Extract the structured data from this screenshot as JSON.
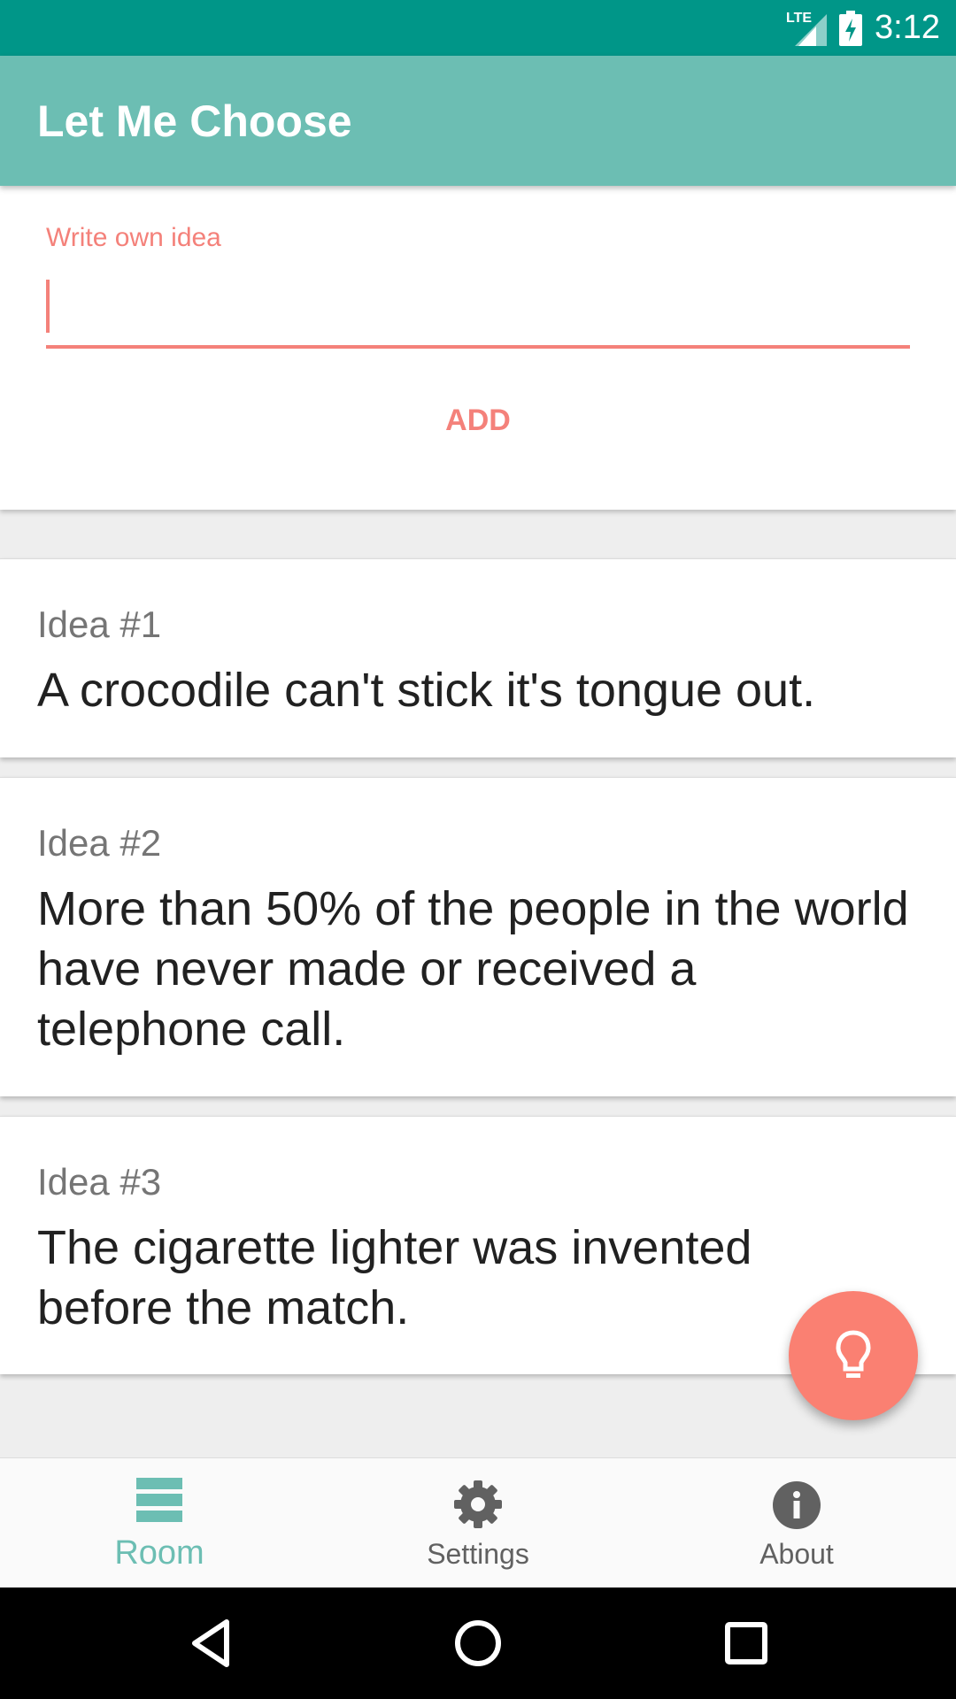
{
  "status_bar": {
    "network_label": "LTE",
    "time": "3:12"
  },
  "app_bar": {
    "title": "Let Me Choose"
  },
  "idea_input": {
    "label": "Write own idea",
    "value": "",
    "add_label": "ADD"
  },
  "ideas": [
    {
      "title": "Idea #1",
      "text": "A crocodile can't stick it's tongue out."
    },
    {
      "title": "Idea #2",
      "text": "More than 50% of the people in the world have never made or received a telephone call."
    },
    {
      "title": "Idea #3",
      "text": "The cigarette lighter was invented before the match."
    }
  ],
  "fab": {
    "icon": "lightbulb-icon"
  },
  "bottom_nav": {
    "items": [
      {
        "label": "Room",
        "icon": "room-icon",
        "active": true
      },
      {
        "label": "Settings",
        "icon": "gear-icon",
        "active": false
      },
      {
        "label": "About",
        "icon": "info-icon",
        "active": false
      }
    ]
  },
  "colors": {
    "status_bar": "#009688",
    "app_bar": "#6cbeb3",
    "accent": "#f4817a",
    "fab": "#fa8072",
    "active_nav": "#6cbeb3",
    "inactive_nav": "#757575"
  },
  "system_nav": {
    "icons": [
      "back-icon",
      "home-icon",
      "recents-icon"
    ]
  }
}
